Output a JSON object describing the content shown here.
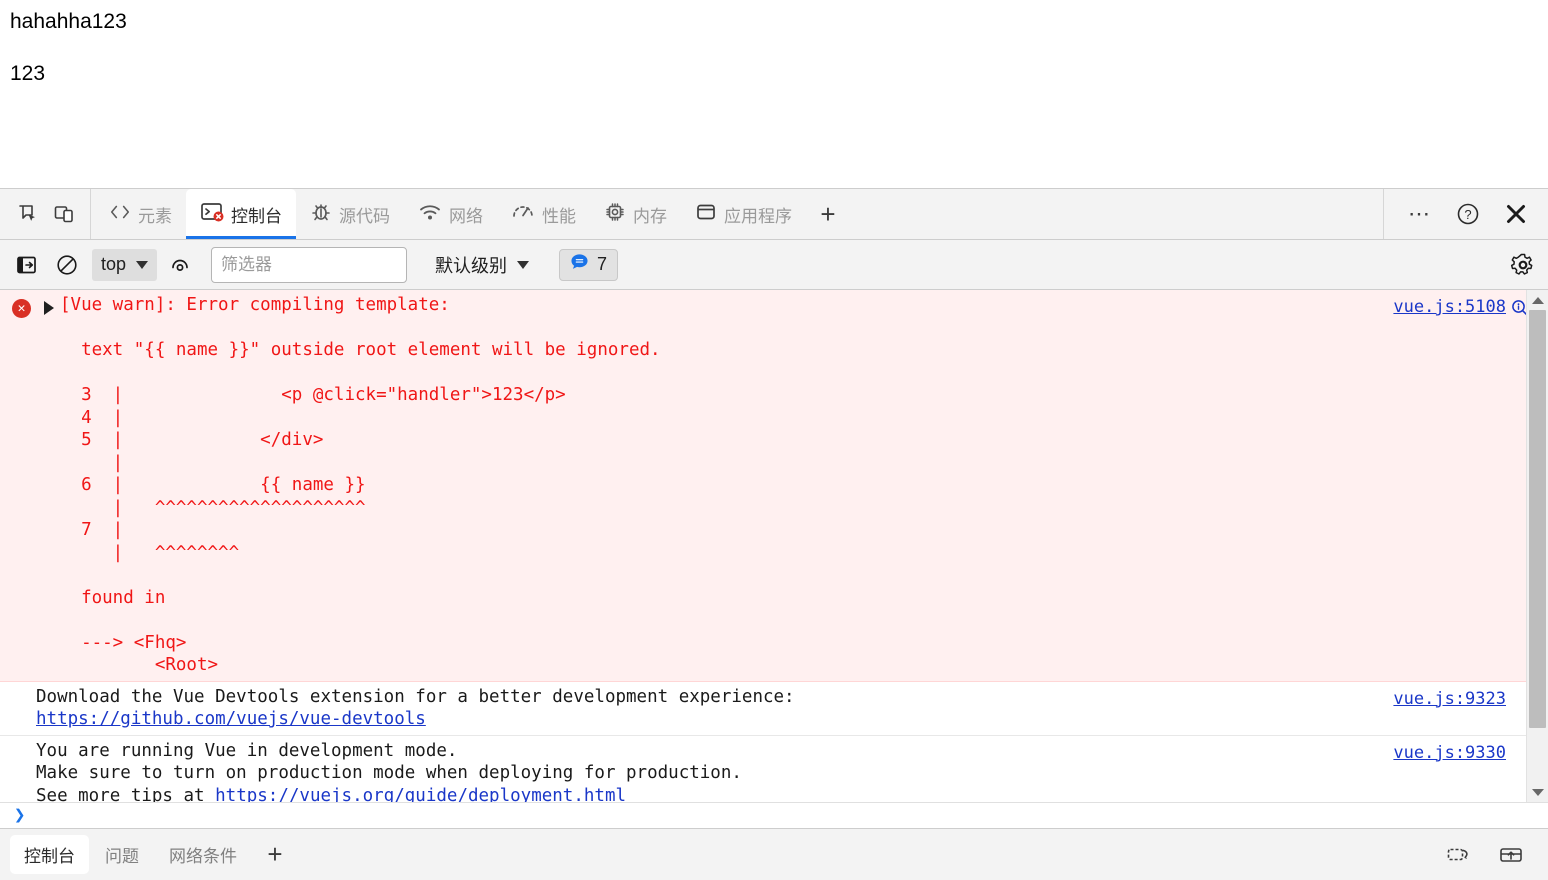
{
  "page": {
    "line1": "hahahha123",
    "line2": "123"
  },
  "devtools": {
    "left_tools": [
      {
        "name": "inspect-element-icon",
        "title": "检查"
      },
      {
        "name": "device-toolbar-icon",
        "title": "设备工具栏"
      }
    ],
    "tabs": [
      {
        "id": "elements",
        "label": "元素",
        "icon": "code-brackets-icon",
        "active": false
      },
      {
        "id": "console",
        "label": "控制台",
        "icon": "console-prompt-icon",
        "active": true,
        "badge": "error"
      },
      {
        "id": "sources",
        "label": "源代码",
        "icon": "bug-icon",
        "active": false
      },
      {
        "id": "network",
        "label": "网络",
        "icon": "wifi-icon",
        "active": false
      },
      {
        "id": "performance",
        "label": "性能",
        "icon": "gauge-icon",
        "active": false
      },
      {
        "id": "memory",
        "label": "内存",
        "icon": "chip-icon",
        "active": false
      },
      {
        "id": "application",
        "label": "应用程序",
        "icon": "window-icon",
        "active": false
      }
    ],
    "add_tab_label": "+",
    "right_tools": [
      {
        "name": "more-options-icon",
        "label": "⋯"
      },
      {
        "name": "help-icon",
        "label": "?"
      },
      {
        "name": "close-devtools-icon",
        "label": "✕"
      }
    ]
  },
  "console_toolbar": {
    "sidebar_toggle": "console-sidebar-icon",
    "clear_button": "clear-console-icon",
    "context_value": "top",
    "eye_button": "live-expression-icon",
    "filter_placeholder": "筛选器",
    "filter_value": "",
    "levels_label": "默认级别",
    "message_count": "7",
    "settings_button": "settings-gear-icon"
  },
  "console_messages": [
    {
      "type": "error",
      "icon": "error-circle-icon",
      "expandable": true,
      "text": "[Vue warn]: Error compiling template:\n\n  text \"{{ name }}\" outside root element will be ignored.\n\n  3  |               <p @click=\"handler\">123</p>\n  4  |\n  5  |             </div>\n     |\n  6  |             {{ name }}\n     |   ^^^^^^^^^^^^^^^^^^^^\n  7  |\n     |   ^^^^^^^^\n\n  found in\n\n  ---> <Fhq>\n         <Root>",
      "source": "vue.js:5108",
      "has_search_icon": true
    },
    {
      "type": "info",
      "text_before": "Download the Vue Devtools extension for a better development experience:\n",
      "link": "https://github.com/vuejs/vue-devtools",
      "text_after": "",
      "source": "vue.js:9323"
    },
    {
      "type": "info",
      "text_before": "You are running Vue in development mode.\nMake sure to turn on production mode when deploying for production.\nSee more tips at ",
      "link": "https://vuejs.org/guide/deployment.html",
      "text_after": "",
      "source": "vue.js:9330"
    }
  ],
  "prompt": {
    "chevron": "›",
    "value": ""
  },
  "drawer": {
    "tabs": [
      {
        "id": "console-drawer",
        "label": "控制台",
        "active": true
      },
      {
        "id": "issues",
        "label": "问题",
        "active": false
      },
      {
        "id": "network-conditions",
        "label": "网络条件",
        "active": false
      }
    ],
    "add_label": "+",
    "right_tools": [
      {
        "name": "screenshot-capture-icon"
      },
      {
        "name": "dock-panel-icon"
      }
    ]
  },
  "colors": {
    "accent": "#1a73e8",
    "error_text": "#f01616",
    "error_bg": "#fff0f0",
    "link": "#1a37c8",
    "error_icon": "#d93025"
  }
}
